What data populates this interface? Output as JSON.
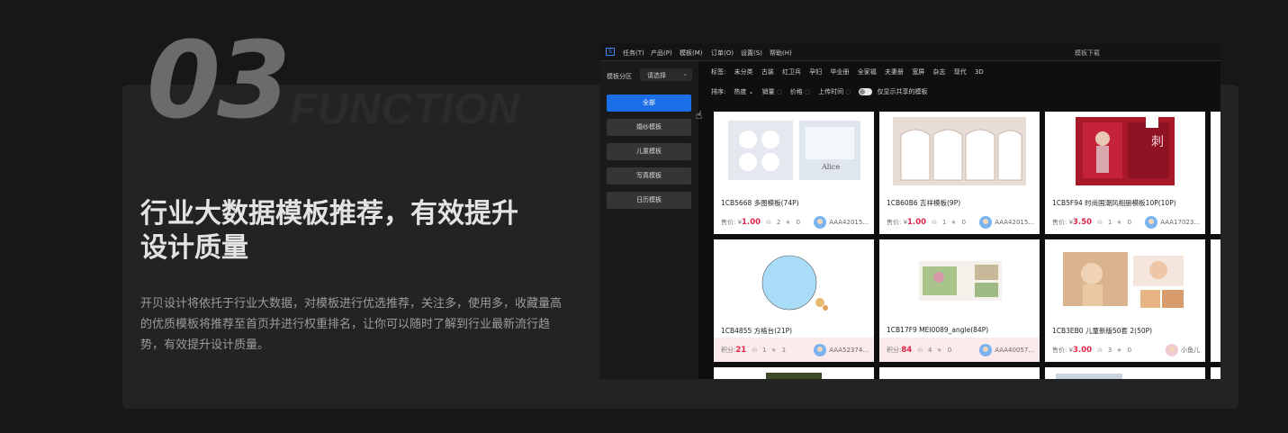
{
  "hero": {
    "number": "03",
    "word": "FUNCTION",
    "headline_line1": "行业大数据模板推荐，有效提升",
    "headline_line2": "设计质量",
    "description": "开贝设计将依托于行业大数据，对模板进行优选推荐，关注多，使用多，收藏量高的优质模板将推荐至首页并进行权重排名，让你可以随时了解到行业最新流行趋势，有效提升设计质量。"
  },
  "app": {
    "logo_icon": "app-logo-icon",
    "menu": [
      "任务(T)",
      "产品(P)",
      "模板(M)",
      "订单(O)",
      "设置(S)",
      "帮助(H)"
    ],
    "window_title": "模板下载",
    "sidebar": {
      "section_label": "模板分区",
      "select_value": "请选择",
      "buttons": [
        "全部",
        "婚纱模板",
        "儿童模板",
        "写真模板",
        "日历模板"
      ]
    },
    "tags_label": "标签:",
    "tags": [
      "未分类",
      "古装",
      "红卫兵",
      "孕妇",
      "毕业册",
      "全家福",
      "夫妻册",
      "宽屏",
      "杂志",
      "现代",
      "3D"
    ],
    "sort_label": "排序:",
    "sort_options": [
      "热度",
      "销量",
      "价格",
      "上传时间"
    ],
    "share_toggle_label": "仅显示共享的模板",
    "tiles": [
      {
        "title": "1CB5668  多图模板(74P)",
        "price_label": "售价: ¥",
        "price": "1.00",
        "stat1": "2",
        "stat2": "0",
        "author": "AAA42015..."
      },
      {
        "title": "1CB60B6  吉祥模板(9P)",
        "price_label": "售价: ¥",
        "price": "1.00",
        "stat1": "1",
        "stat2": "0",
        "author": "AAA42015..."
      },
      {
        "title": "1CB5F94  时尚国潮风相册模板10P(10P)",
        "price_label": "售价: ¥",
        "price": "3.50",
        "stat1": "1",
        "stat2": "0",
        "author": "AAA17023..."
      },
      {
        "title": "1CB4855  方格台(21P)",
        "price_label": "积分: ",
        "price": "21",
        "stat1": "1",
        "stat2": "1",
        "author": "AAA52374..."
      },
      {
        "title": "1CB17F9  MEI0089_angle(84P)",
        "price_label": "积分: ",
        "price": "84",
        "stat1": "4",
        "stat2": "0",
        "author": "AAA40057..."
      },
      {
        "title": "1CB3EB0  儿童新版50套 2(50P)",
        "price_label": "售价: ¥",
        "price": "3.00",
        "stat1": "3",
        "stat2": "0",
        "author": "小鱼儿"
      }
    ]
  },
  "colors": {
    "accent": "#1a6fe6",
    "price": "#e0254a",
    "background": "#171717",
    "card": "#232323"
  }
}
